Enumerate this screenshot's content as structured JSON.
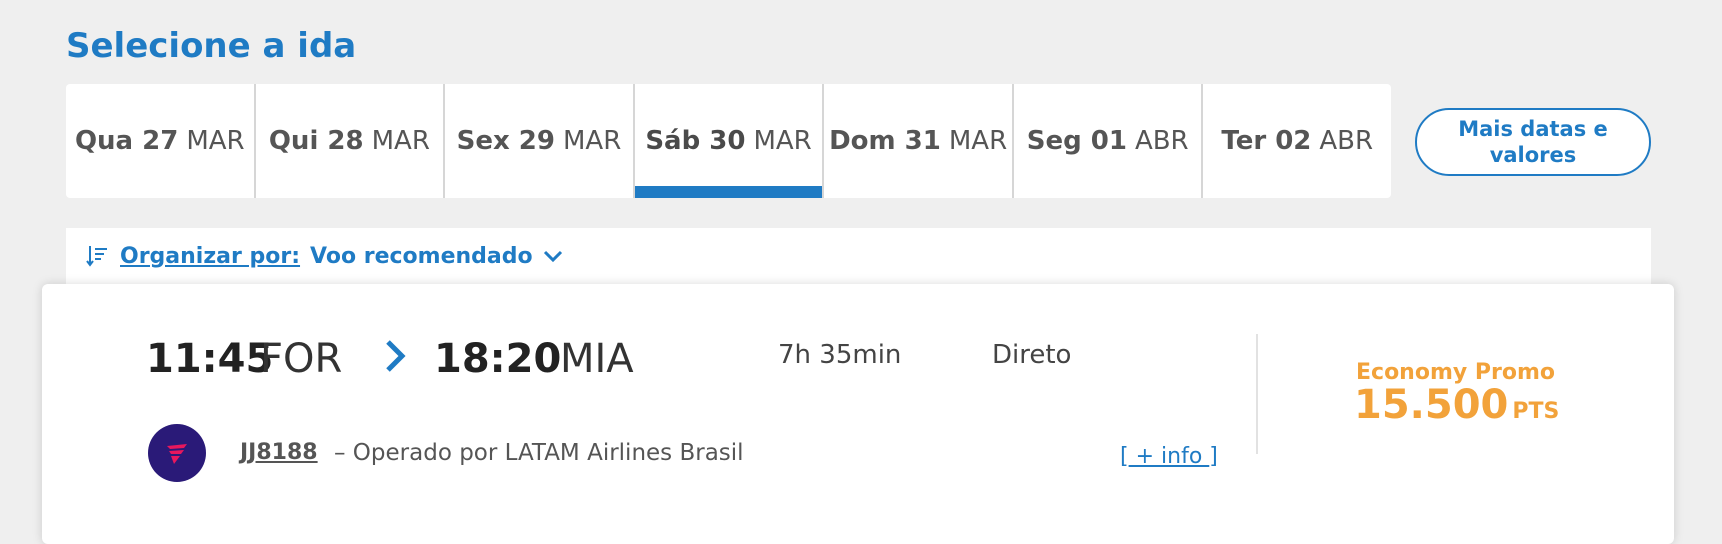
{
  "page": {
    "title": "Selecione a ida"
  },
  "date_tabs": [
    {
      "day": "Qua 27",
      "month": "MAR",
      "active": false
    },
    {
      "day": "Qui 28",
      "month": "MAR",
      "active": false
    },
    {
      "day": "Sex 29",
      "month": "MAR",
      "active": false
    },
    {
      "day": "Sáb 30",
      "month": "MAR",
      "active": true
    },
    {
      "day": "Dom 31",
      "month": "MAR",
      "active": false
    },
    {
      "day": "Seg 01",
      "month": "ABR",
      "active": false
    },
    {
      "day": "Ter 02",
      "month": "ABR",
      "active": false
    }
  ],
  "more_dates": {
    "line1": "Mais datas e",
    "line2": "valores"
  },
  "sort": {
    "label": "Organizar por:",
    "value": "Voo recomendado",
    "icon": "sort-icon"
  },
  "flight": {
    "departure_time": "11:45",
    "departure_code": "FOR",
    "arrival_time": "18:20",
    "arrival_code": "MIA",
    "duration": "7h 35min",
    "stops": "Direto",
    "flight_number": "JJ8188",
    "operated_by": "– Operado por LATAM Airlines Brasil",
    "info_link_open": "[",
    "info_link_text": " + info ",
    "info_link_close": "]",
    "fare_name": "Economy Promo",
    "fare_price": "15.500",
    "fare_unit": "PTS"
  },
  "colors": {
    "brand_blue": "#1f7bc4",
    "fare_orange": "#f2a23a",
    "airline_logo_bg": "#2a1a78"
  }
}
